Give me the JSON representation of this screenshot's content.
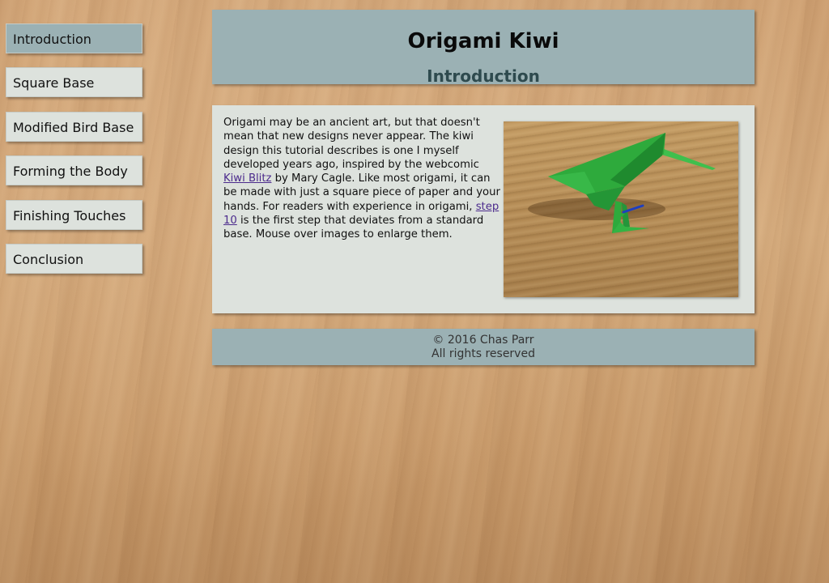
{
  "nav": {
    "items": [
      {
        "label": "Introduction",
        "active": true
      },
      {
        "label": "Square Base"
      },
      {
        "label": "Modified Bird Base"
      },
      {
        "label": "Forming the Body"
      },
      {
        "label": "Finishing Touches"
      },
      {
        "label": "Conclusion"
      }
    ]
  },
  "header": {
    "title": "Origami Kiwi",
    "subtitle": "Introduction"
  },
  "content": {
    "text_1": "Origami may be an ancient art, but that doesn't mean that new designs never appear. The kiwi design this tutorial describes is one I myself developed years ago, inspired by the webcomic ",
    "link_kiwi_blitz": "Kiwi Blitz",
    "text_2": " by Mary Cagle. Like most origami, it can be made with just a square piece of paper and your hands. For readers with experience in origami, ",
    "link_step_10": "step 10",
    "text_3": " is the first step that deviates from a standard base. Mouse over images to enlarge them."
  },
  "footer": {
    "copyright": "© 2016 Chas Parr",
    "rights": "All rights reserved"
  },
  "colors": {
    "panel_blue": "#9bb1b4",
    "panel_light": "#dde2dd",
    "subtitle": "#2e4a4e",
    "link": "#4b2a8c",
    "origami_green": "#2eaa3c"
  }
}
